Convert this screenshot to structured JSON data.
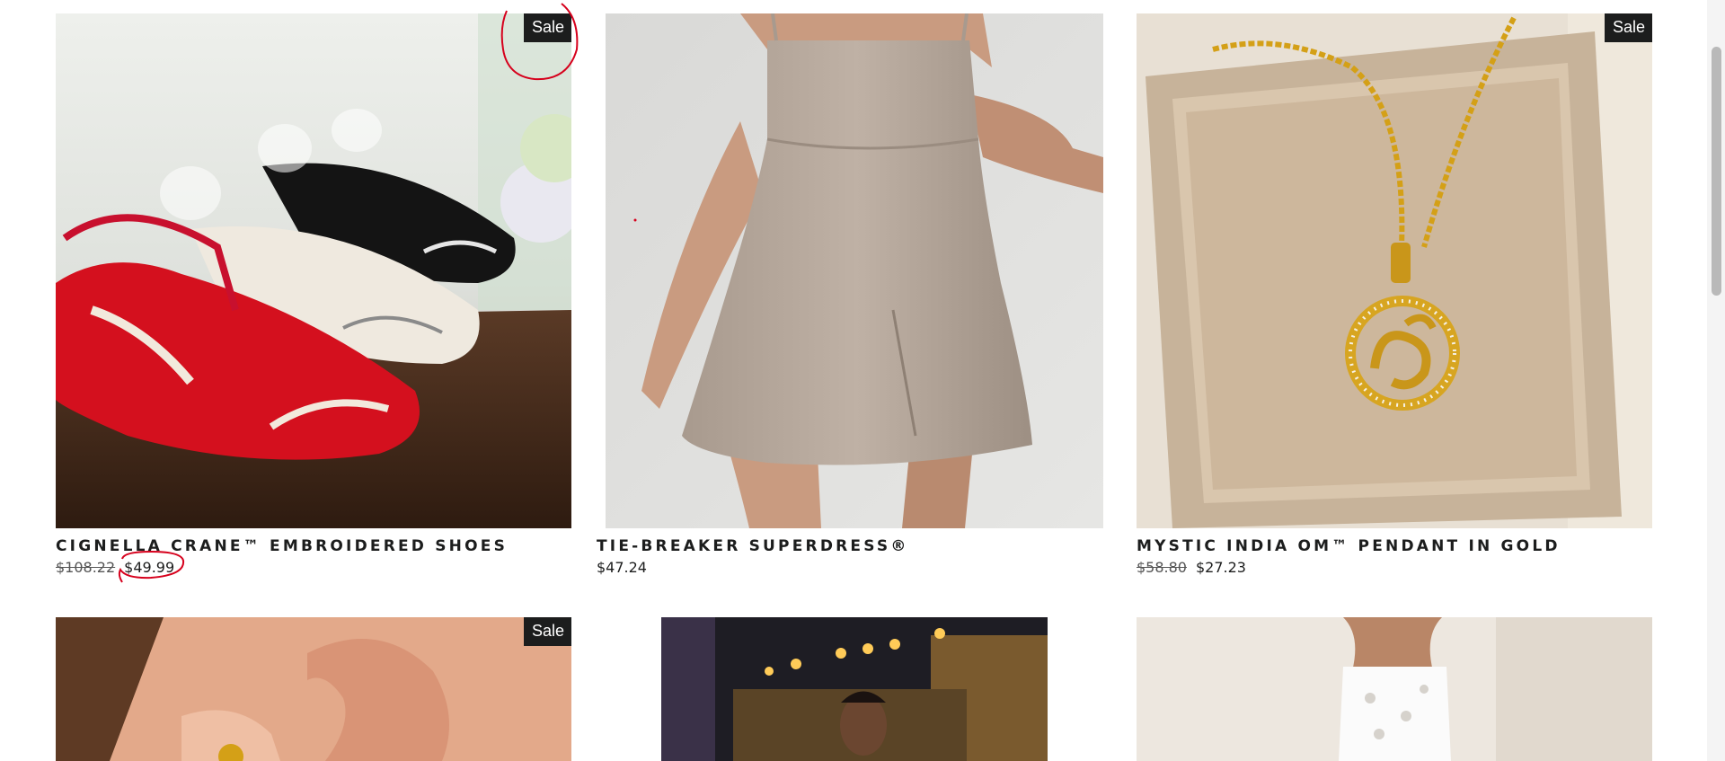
{
  "products": [
    {
      "title": "Cignella Crane™ Embroidered Shoes",
      "price_old": "$108.22",
      "price": "$49.99",
      "badge": "Sale",
      "image": "embroidered-crane-shoes"
    },
    {
      "title": "Tie-Breaker Superdress®",
      "price": "$47.24",
      "image": "taupe-mini-dress"
    },
    {
      "title": "Mystic India Om™ Pendant in Gold",
      "price_old": "$58.80",
      "price": "$27.23",
      "badge": "Sale",
      "image": "gold-om-pendant"
    },
    {
      "badge": "Sale",
      "image": "gold-stud-earring-closeup"
    },
    {
      "image": "evening-gown-city-night"
    },
    {
      "image": "white-embroidered-strapless-dress"
    }
  ],
  "colors": {
    "badge_bg": "#1c1d1d",
    "annotation": "#d6001c",
    "text": "#1c1d1d"
  }
}
